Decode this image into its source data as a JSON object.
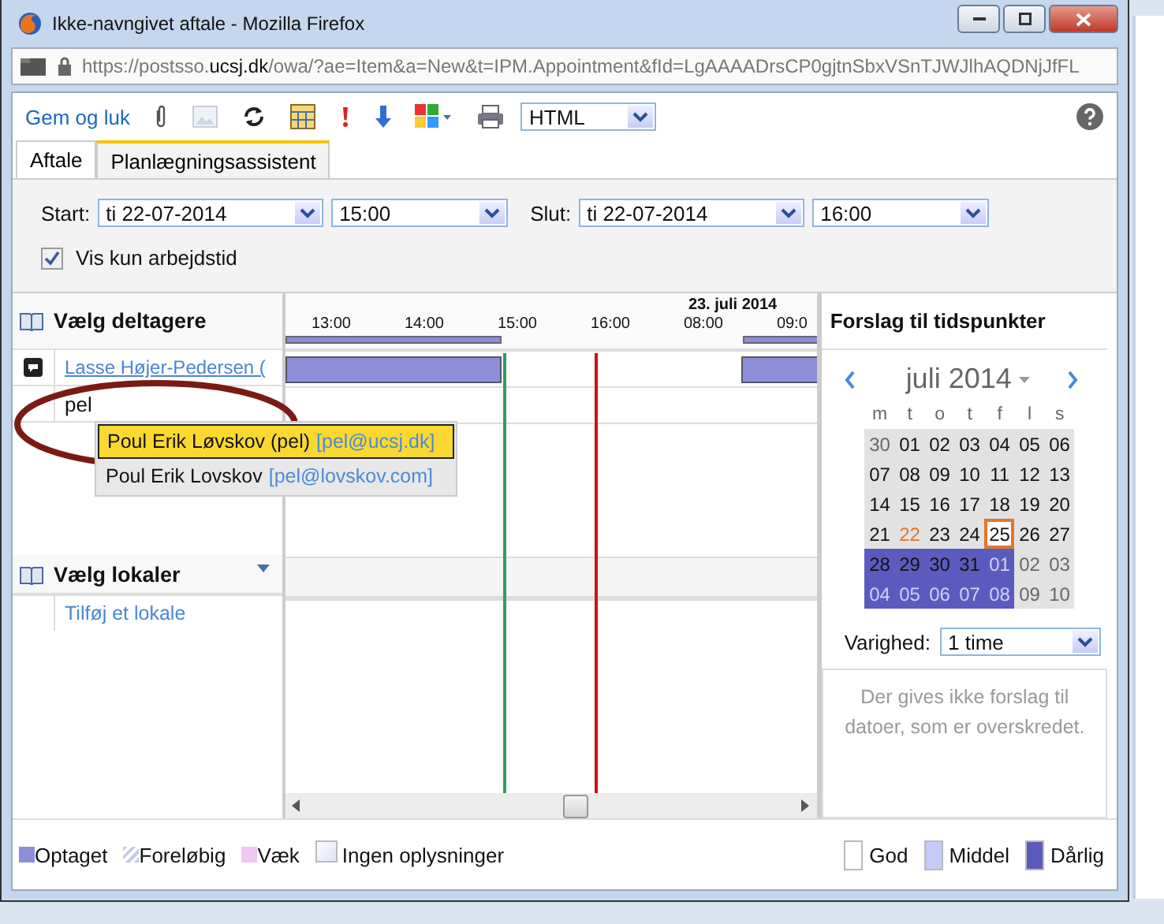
{
  "window": {
    "title": "Ikke-navngivet aftale - Mozilla Firefox",
    "url": "https://postsso.**ucsj.dk**/owa/?ae=Item&a=New&t=IPM.Appointment&fId=LgAAAADrsCP0gjtnSbxVSnTJWJlhAQDNjJfFL"
  },
  "toolbar": {
    "save": "Gem og luk",
    "format": "HTML"
  },
  "tabs": [
    {
      "label": "Aftale",
      "selected": false
    },
    {
      "label": "Planlægningsassistent",
      "selected": true
    }
  ],
  "start": {
    "label": "Start:",
    "date": "ti 22-07-2014",
    "time": "15:00"
  },
  "end": {
    "label": "Slut:",
    "date": "ti 22-07-2014",
    "time": "16:00"
  },
  "work_hours": {
    "label": "Vis kun arbejdstid",
    "checked": true
  },
  "attendees": {
    "header": "Vælg deltagere",
    "attendee": "Lasse Højer-Pedersen (",
    "input": "pel",
    "suggestions": [
      {
        "name": "Poul Erik Løvskov (pel)",
        "email": "[pel@ucsj.dk]",
        "selected": true
      },
      {
        "name": "Poul Erik Lovskov",
        "email": "[pel@lovskov.com]",
        "selected": false
      }
    ]
  },
  "rooms": {
    "header": "Vælg lokaler",
    "add": "Tilføj et lokale"
  },
  "timeline": {
    "date": "23. juli 2014",
    "times": [
      "13:00",
      "14:00",
      "15:00",
      "16:00",
      "08:00",
      "09:0"
    ]
  },
  "panel": {
    "title": "Forslag til tidspunkter",
    "month": "juli 2014",
    "weekdays": [
      "m",
      "t",
      "o",
      "t",
      "f",
      "l",
      "s"
    ],
    "days": [
      {
        "label": "30",
        "other": true,
        "poor": false,
        "today": false,
        "selected": false
      },
      {
        "label": "01",
        "other": false,
        "poor": false,
        "today": false,
        "selected": false
      },
      {
        "label": "02",
        "other": false,
        "poor": false,
        "today": false,
        "selected": false
      },
      {
        "label": "03",
        "other": false,
        "poor": false,
        "today": false,
        "selected": false
      },
      {
        "label": "04",
        "other": false,
        "poor": false,
        "today": false,
        "selected": false
      },
      {
        "label": "05",
        "other": false,
        "poor": false,
        "today": false,
        "selected": false
      },
      {
        "label": "06",
        "other": false,
        "poor": false,
        "today": false,
        "selected": false
      },
      {
        "label": "07",
        "other": false,
        "poor": false,
        "today": false,
        "selected": false
      },
      {
        "label": "08",
        "other": false,
        "poor": false,
        "today": false,
        "selected": false
      },
      {
        "label": "09",
        "other": false,
        "poor": false,
        "today": false,
        "selected": false
      },
      {
        "label": "10",
        "other": false,
        "poor": false,
        "today": false,
        "selected": false
      },
      {
        "label": "11",
        "other": false,
        "poor": false,
        "today": false,
        "selected": false
      },
      {
        "label": "12",
        "other": false,
        "poor": false,
        "today": false,
        "selected": false
      },
      {
        "label": "13",
        "other": false,
        "poor": false,
        "today": false,
        "selected": false
      },
      {
        "label": "14",
        "other": false,
        "poor": false,
        "today": false,
        "selected": false
      },
      {
        "label": "15",
        "other": false,
        "poor": false,
        "today": false,
        "selected": false
      },
      {
        "label": "16",
        "other": false,
        "poor": false,
        "today": false,
        "selected": false
      },
      {
        "label": "17",
        "other": false,
        "poor": false,
        "today": false,
        "selected": false
      },
      {
        "label": "18",
        "other": false,
        "poor": false,
        "today": false,
        "selected": false
      },
      {
        "label": "19",
        "other": false,
        "poor": false,
        "today": false,
        "selected": false
      },
      {
        "label": "20",
        "other": false,
        "poor": false,
        "today": false,
        "selected": false
      },
      {
        "label": "21",
        "other": false,
        "poor": false,
        "today": false,
        "selected": false
      },
      {
        "label": "22",
        "other": false,
        "poor": false,
        "today": true,
        "selected": false
      },
      {
        "label": "23",
        "other": false,
        "poor": false,
        "today": false,
        "selected": false
      },
      {
        "label": "24",
        "other": false,
        "poor": false,
        "today": false,
        "selected": false
      },
      {
        "label": "25",
        "other": false,
        "poor": false,
        "today": false,
        "selected": true
      },
      {
        "label": "26",
        "other": false,
        "poor": false,
        "today": false,
        "selected": false
      },
      {
        "label": "27",
        "other": false,
        "poor": false,
        "today": false,
        "selected": false
      },
      {
        "label": "28",
        "other": false,
        "poor": true,
        "today": false,
        "selected": false
      },
      {
        "label": "29",
        "other": false,
        "poor": true,
        "today": false,
        "selected": false
      },
      {
        "label": "30",
        "other": false,
        "poor": true,
        "today": false,
        "selected": false
      },
      {
        "label": "31",
        "other": false,
        "poor": true,
        "today": false,
        "selected": false
      },
      {
        "label": "01",
        "other": true,
        "poor": true,
        "today": false,
        "selected": false
      },
      {
        "label": "02",
        "other": true,
        "poor": false,
        "today": false,
        "selected": false
      },
      {
        "label": "03",
        "other": true,
        "poor": false,
        "today": false,
        "selected": false
      },
      {
        "label": "04",
        "other": true,
        "poor": true,
        "today": false,
        "selected": false
      },
      {
        "label": "05",
        "other": true,
        "poor": true,
        "today": false,
        "selected": false
      },
      {
        "label": "06",
        "other": true,
        "poor": true,
        "today": false,
        "selected": false
      },
      {
        "label": "07",
        "other": true,
        "poor": true,
        "today": false,
        "selected": false
      },
      {
        "label": "08",
        "other": true,
        "poor": true,
        "today": false,
        "selected": false
      },
      {
        "label": "09",
        "other": true,
        "poor": false,
        "today": false,
        "selected": false
      },
      {
        "label": "10",
        "other": true,
        "poor": false,
        "today": false,
        "selected": false
      }
    ],
    "duration_label": "Varighed:",
    "duration": "1 time",
    "message": "Der gives ikke forslag til datoer, som er overskredet."
  },
  "legend": [
    {
      "label": "Optaget",
      "kind": "busy"
    },
    {
      "label": "Foreløbig",
      "kind": "tentative"
    },
    {
      "label": "Væk",
      "kind": "away"
    },
    {
      "label": "Ingen oplysninger",
      "kind": "none"
    }
  ],
  "quality": [
    {
      "label": "God",
      "color": "#ffffff"
    },
    {
      "label": "Middel",
      "color": "#c5cbf5"
    },
    {
      "label": "Dårlig",
      "color": "#5b5bbf"
    }
  ]
}
